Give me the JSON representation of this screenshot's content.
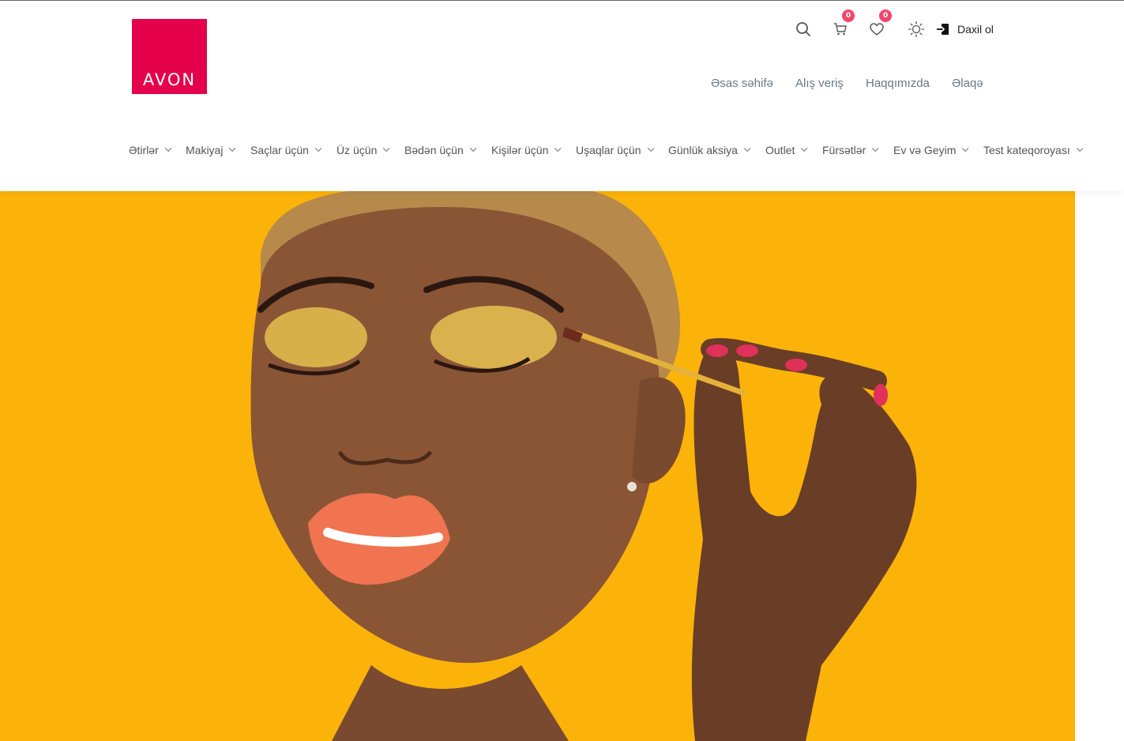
{
  "brand": {
    "logo_text": "AVON",
    "color": "#e4004a"
  },
  "utility": {
    "search_icon": "search-icon",
    "cart_count": "0",
    "wishlist_count": "0",
    "theme_icon": "sun-icon",
    "login_label": "Daxil ol",
    "badge_color": "#f0466e"
  },
  "main_nav": [
    {
      "label": "Əsas səhifə"
    },
    {
      "label": "Alış veriş"
    },
    {
      "label": "Haqqımızda"
    },
    {
      "label": "Əlaqə"
    }
  ],
  "categories": [
    {
      "label": "Ətirlər"
    },
    {
      "label": "Makiyaj"
    },
    {
      "label": "Saçlar üçün"
    },
    {
      "label": "Üz üçün"
    },
    {
      "label": "Bədən üçün"
    },
    {
      "label": "Kişilər üçün"
    },
    {
      "label": "Uşaqlar üçün"
    },
    {
      "label": "Günlük aksiya"
    },
    {
      "label": "Outlet"
    },
    {
      "label": "Fürsətlər"
    },
    {
      "label": "Ev və Geyim"
    },
    {
      "label": "Test kateqoroyası"
    }
  ],
  "hero": {
    "background": "#fbb30a"
  }
}
